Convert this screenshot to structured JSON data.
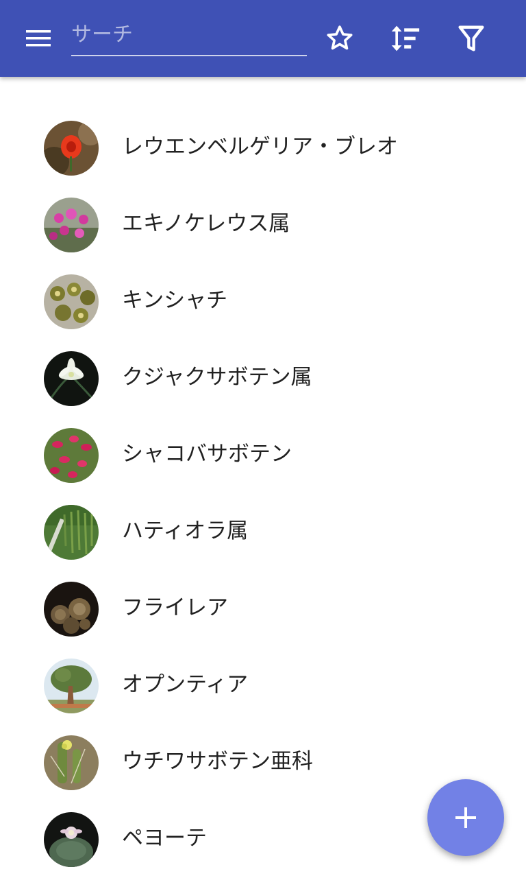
{
  "toolbar": {
    "search_placeholder": "サーチ",
    "color": "#3f51b5",
    "icons": [
      "menu-icon",
      "star-icon",
      "sort-icon",
      "filter-icon"
    ]
  },
  "plants": [
    {
      "name": "レウエンベルゲリア・ブレオ",
      "thumb": "orange-flower"
    },
    {
      "name": "エキノケレウス属",
      "thumb": "pink-flowers"
    },
    {
      "name": "キンシャチ",
      "thumb": "golden-barrel"
    },
    {
      "name": "クジャクサボテン属",
      "thumb": "white-flower"
    },
    {
      "name": "シャコバサボテン",
      "thumb": "christmas-cactus"
    },
    {
      "name": "ハティオラ属",
      "thumb": "hanging-green"
    },
    {
      "name": "フライレア",
      "thumb": "small-cacti"
    },
    {
      "name": "オプンティア",
      "thumb": "tree"
    },
    {
      "name": "ウチワサボテン亜科",
      "thumb": "cholla"
    },
    {
      "name": "ペヨーテ",
      "thumb": "peyote"
    }
  ],
  "fab": {
    "icon": "add-icon",
    "color": "#7281e6"
  }
}
